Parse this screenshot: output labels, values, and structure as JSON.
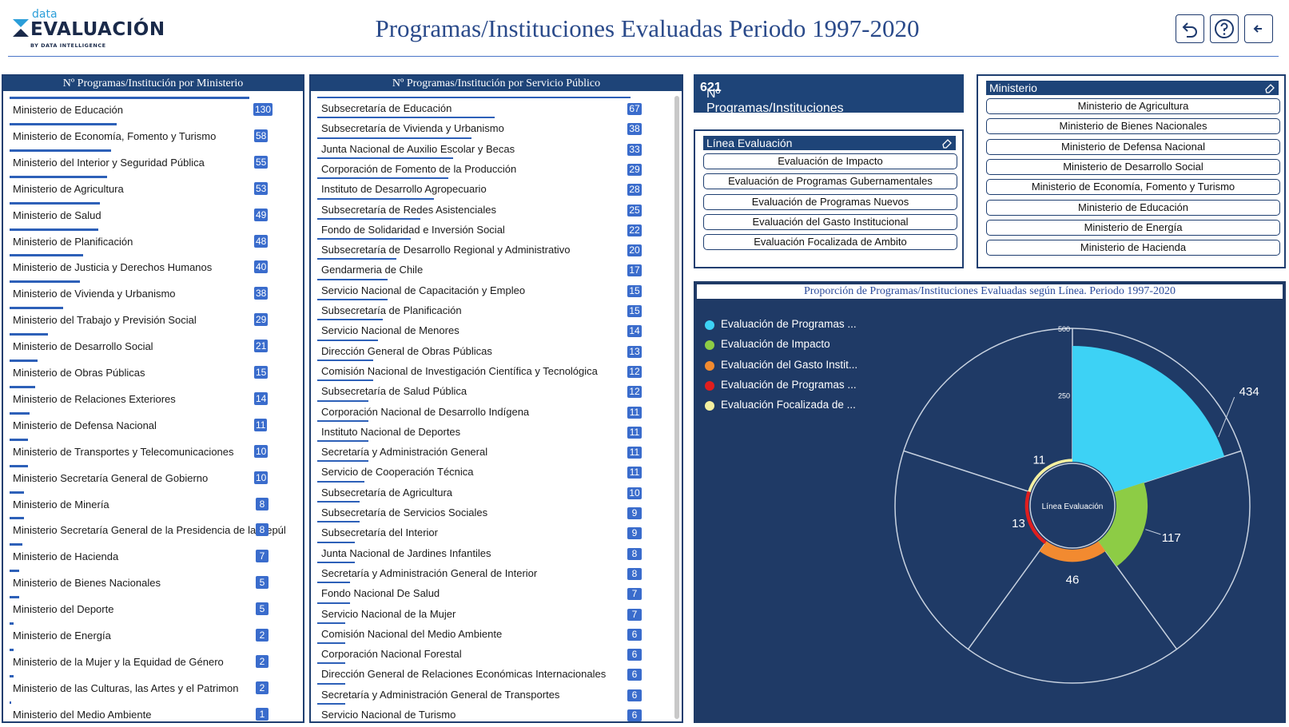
{
  "header": {
    "logo_top": "data",
    "logo_main": "EVALUACIÓN",
    "logo_sub": "BY DATA INTELLIGENCE",
    "title": "Programas/Instituciones Evaluadas Periodo 1997-2020",
    "buttons": [
      "undo-icon",
      "help-icon",
      "back-arrow-icon"
    ]
  },
  "ministerio_panel": {
    "title": "Nº Programas/Institución por Ministerio",
    "items": [
      {
        "label": "Ministerio de Educación",
        "value": "130"
      },
      {
        "label": "Ministerio de Economía, Fomento y Turismo",
        "value": "58"
      },
      {
        "label": "Ministerio del Interior y Seguridad Pública",
        "value": "55"
      },
      {
        "label": "Ministerio de Agricultura",
        "value": "53"
      },
      {
        "label": "Ministerio de Salud",
        "value": "49"
      },
      {
        "label": "Ministerio de Planificación",
        "value": "48"
      },
      {
        "label": "Ministerio de Justicia y Derechos Humanos",
        "value": "40"
      },
      {
        "label": "Ministerio de Vivienda y Urbanismo",
        "value": "38"
      },
      {
        "label": "Ministerio del Trabajo y Previsión Social",
        "value": "29"
      },
      {
        "label": "Ministerio de Desarrollo Social",
        "value": "21"
      },
      {
        "label": "Ministerio de Obras Públicas",
        "value": "15"
      },
      {
        "label": "Ministerio de Relaciones Exteriores",
        "value": "14"
      },
      {
        "label": "Ministerio de Defensa Nacional",
        "value": "11"
      },
      {
        "label": "Ministerio de Transportes y Telecomunicaciones",
        "value": "10"
      },
      {
        "label": "Ministerio Secretaría General de Gobierno",
        "value": "10"
      },
      {
        "label": "Ministerio de Minería",
        "value": "8"
      },
      {
        "label": "Ministerio Secretaría General de la Presidencia de la Repúl",
        "value": "8"
      },
      {
        "label": "Ministerio de Hacienda",
        "value": "7"
      },
      {
        "label": "Ministerio de Bienes Nacionales",
        "value": "5"
      },
      {
        "label": "Ministerio del Deporte",
        "value": "5"
      },
      {
        "label": "Ministerio de Energía",
        "value": "2"
      },
      {
        "label": "Ministerio de la Mujer y la Equidad de Género",
        "value": "2"
      },
      {
        "label": "Ministerio de las Culturas, las Artes y el Patrimon",
        "value": "2"
      },
      {
        "label": "Ministerio del Medio Ambiente",
        "value": "1"
      }
    ]
  },
  "servicio_panel": {
    "title": "Nº Programas/Institución por Servicio Público",
    "items": [
      {
        "label": "Subsecretaría de Educación",
        "value": "67"
      },
      {
        "label": "Subsecretaría de Vivienda y Urbanismo",
        "value": "38"
      },
      {
        "label": "Junta Nacional de Auxilio Escolar y Becas",
        "value": "33"
      },
      {
        "label": "Corporación de Fomento de la Producción",
        "value": "29"
      },
      {
        "label": "Instituto de Desarrollo Agropecuario",
        "value": "28"
      },
      {
        "label": "Subsecretaría de Redes Asistenciales",
        "value": "25"
      },
      {
        "label": "Fondo de Solidaridad e Inversión Social",
        "value": "22"
      },
      {
        "label": "Subsecretaría de Desarrollo Regional y Administrativo",
        "value": "20"
      },
      {
        "label": "Gendarmeria de Chile",
        "value": "17"
      },
      {
        "label": "Servicio Nacional de Capacitación y Empleo",
        "value": "15"
      },
      {
        "label": "Subsecretaría de Planificación",
        "value": "15"
      },
      {
        "label": "Servicio Nacional de Menores",
        "value": "14"
      },
      {
        "label": "Dirección General de Obras Públicas",
        "value": "13"
      },
      {
        "label": "Comisión Nacional de Investigación Científica y Tecnológica",
        "value": "12"
      },
      {
        "label": "Subsecretaría de Salud Pública",
        "value": "12"
      },
      {
        "label": "Corporación Nacional de Desarrollo Indígena",
        "value": "11"
      },
      {
        "label": "Instituto Nacional de Deportes",
        "value": "11"
      },
      {
        "label": "Secretaría y Administración General",
        "value": "11"
      },
      {
        "label": "Servicio de Cooperación Técnica",
        "value": "11"
      },
      {
        "label": "Subsecretaría de Agricultura",
        "value": "10"
      },
      {
        "label": "Subsecretaría de Servicios Sociales",
        "value": "9"
      },
      {
        "label": "Subsecretaría del Interior",
        "value": "9"
      },
      {
        "label": "Junta Nacional de Jardines Infantiles",
        "value": "8"
      },
      {
        "label": "Secretaría y Administración General de Interior",
        "value": "8"
      },
      {
        "label": "Fondo Nacional De Salud",
        "value": "7"
      },
      {
        "label": "Servicio Nacional de la Mujer",
        "value": "7"
      },
      {
        "label": "Comisión Nacional del Medio Ambiente",
        "value": "6"
      },
      {
        "label": "Corporación Nacional Forestal",
        "value": "6"
      },
      {
        "label": "Dirección General de Relaciones Económicas Internacionales",
        "value": "6"
      },
      {
        "label": "Secretaría y Administración General de Transportes",
        "value": "6"
      },
      {
        "label": "Servicio Nacional de Turismo",
        "value": "6"
      }
    ]
  },
  "kpi": {
    "label": "Nº Programas/Instituciones :",
    "value": "621"
  },
  "linea_filter": {
    "title": "Línea Evaluación",
    "options": [
      "Evaluación de Impacto",
      "Evaluación de Programas Gubernamentales",
      "Evaluación de Programas Nuevos",
      "Evaluación del Gasto Institucional",
      "Evaluación Focalizada de Ambito"
    ]
  },
  "ministerio_filter": {
    "title": "Ministerio",
    "options": [
      "Ministerio de Agricultura",
      "Ministerio de Bienes Nacionales",
      "Ministerio de Defensa Nacional",
      "Ministerio de Desarrollo Social",
      "Ministerio de Economía, Fomento y Turismo",
      "Ministerio de Educación",
      "Ministerio de Energía",
      "Ministerio de Hacienda"
    ]
  },
  "chart_data": {
    "type": "polar-area",
    "title": "Proporción de Programas/Instituciones Evaluadas según Línea. Periodo 1997-2020",
    "center_label": "Línea Evaluación",
    "r_ticks": [
      "500",
      "250"
    ],
    "rmax": 500,
    "series": [
      {
        "name": "Evaluación de Programas ...",
        "value": 434,
        "color": "#3dd2f5"
      },
      {
        "name": "Evaluación de Impacto",
        "value": 117,
        "color": "#8dcc45"
      },
      {
        "name": "Evaluación del Gasto Instit...",
        "value": 46,
        "color": "#f28a30"
      },
      {
        "name": "Evaluación de Programas ...",
        "value": 13,
        "color": "#e01e1e"
      },
      {
        "name": "Evaluación Focalizada de ...",
        "value": 11,
        "color": "#f5f0a0"
      }
    ]
  }
}
